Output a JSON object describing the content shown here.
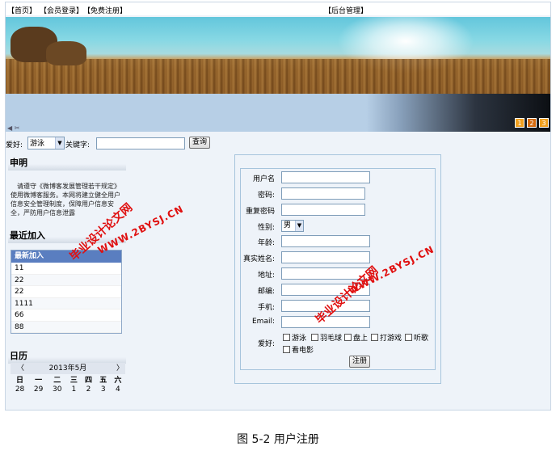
{
  "topnav": {
    "home": "【首页】",
    "login": "【会员登录】",
    "register": "【免费注册】",
    "admin": "【后台管理】"
  },
  "banner": {
    "pages": [
      "1",
      "2",
      "3"
    ],
    "active_page": "2"
  },
  "search": {
    "hobby_label": "爱好:",
    "hobby_value": "游泳",
    "keyword_label": "关键字:",
    "keyword_value": "",
    "button": "查询"
  },
  "sidebar": {
    "notice_title": "申明",
    "notice_text": "请遵守《微博客发展管理若干规定》使用微博客服务。本网将建立健全用户信息安全管理制度，保障用户信息安全，严防用户信息泄露",
    "recent_title": "最近加入",
    "recent_header": "最新加入",
    "recent_items": [
      "11",
      "22",
      "22",
      "1111",
      "66",
      "88"
    ],
    "calendar_title": "日历",
    "calendar_month": "2013年5月",
    "calendar_prev": "〈",
    "calendar_next": "〉",
    "weekdays": [
      "日",
      "一",
      "二",
      "三",
      "四",
      "五",
      "六"
    ],
    "first_week": [
      "28",
      "29",
      "30",
      "1",
      "2",
      "3",
      "4"
    ]
  },
  "form": {
    "username_label": "用户名",
    "password_label": "密码:",
    "confirm_label": "重复密码",
    "gender_label": "性别:",
    "gender_value": "男",
    "age_label": "年龄:",
    "realname_label": "真实姓名:",
    "address_label": "地址:",
    "zip_label": "邮编:",
    "phone_label": "手机:",
    "email_label": "Email:",
    "hobby_label": "爱好:",
    "hobbies": [
      "游泳",
      "羽毛球",
      "盘上",
      "打游戏",
      "听歌",
      "看电影"
    ],
    "submit": "注册"
  },
  "watermarks": {
    "brand": "毕业设计论文网",
    "url": "WWW.2BYSJ.CN"
  },
  "caption": "图 5-2 用户注册",
  "colors": {
    "watermark": "#e01010",
    "list_header": "#5a7ec0",
    "page_badge": "#f0a020"
  }
}
